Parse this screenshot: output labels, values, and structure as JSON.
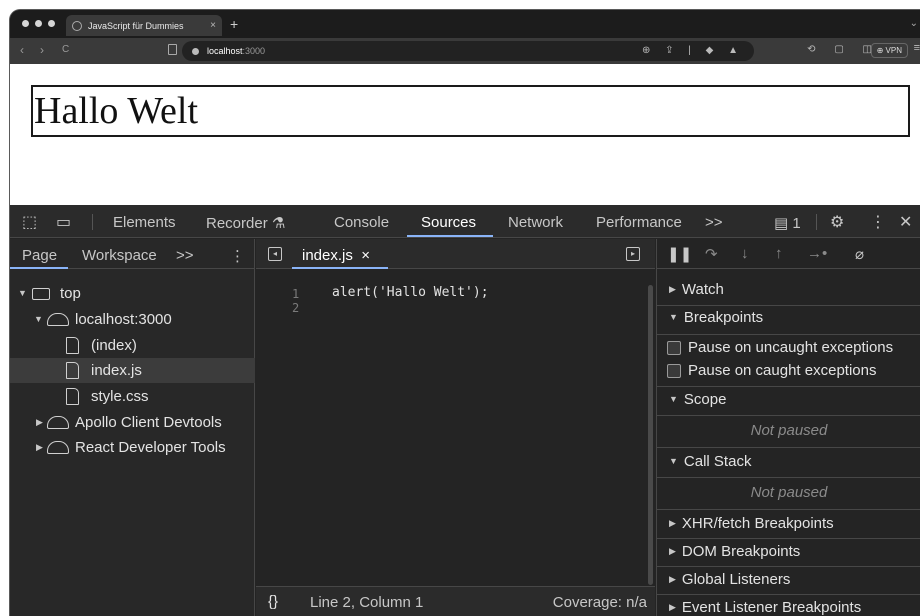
{
  "browser": {
    "tab_title": "JavaScript für Dummies",
    "tab_close": "×",
    "new_tab": "+",
    "nav_back": "‹",
    "nav_forward": "›",
    "nav_reload": "C",
    "url_host": "localhost",
    "url_port": ":3000",
    "vpn_label": "VPN"
  },
  "page": {
    "heading": "Hallo Welt"
  },
  "devtools": {
    "tabs": [
      "Elements",
      "Recorder",
      "Console",
      "Sources",
      "Network",
      "Performance"
    ],
    "active_tab": "Sources",
    "more_tabs": ">>",
    "issues_count": "1",
    "navigator": {
      "tabs": [
        "Page",
        "Workspace"
      ],
      "more": ">>",
      "tree": [
        {
          "label": "top",
          "icon": "frame-icon",
          "expanded": true,
          "level": 0
        },
        {
          "label": "localhost:3000",
          "icon": "cloud-icon",
          "expanded": true,
          "level": 1
        },
        {
          "label": "(index)",
          "icon": "file-icon",
          "level": 2
        },
        {
          "label": "index.js",
          "icon": "file-icon",
          "level": 2,
          "selected": true
        },
        {
          "label": "style.css",
          "icon": "file-icon",
          "level": 2
        },
        {
          "label": "Apollo Client Devtools",
          "icon": "cloud-icon",
          "expanded": false,
          "level": 1
        },
        {
          "label": "React Developer Tools",
          "icon": "cloud-icon",
          "expanded": false,
          "level": 1
        }
      ]
    },
    "editor": {
      "file_tab": "index.js",
      "close": "×",
      "line_numbers": [
        "1",
        "2"
      ],
      "code_line_1": "alert('Hallo Welt');",
      "status_braces": "{}",
      "status_position": "Line 2, Column 1",
      "coverage": "Coverage: n/a"
    },
    "debugger": {
      "watch": "Watch",
      "breakpoints": "Breakpoints",
      "pause_uncaught": "Pause on uncaught exceptions",
      "pause_caught": "Pause on caught exceptions",
      "scope": "Scope",
      "scope_status": "Not paused",
      "call_stack": "Call Stack",
      "call_stack_status": "Not paused",
      "xhr": "XHR/fetch Breakpoints",
      "dom": "DOM Breakpoints",
      "global": "Global Listeners",
      "event": "Event Listener Breakpoints"
    }
  },
  "colors": {
    "accent": "#8ab4f8",
    "devtools_bg": "#242424",
    "panel_bg": "#2b2b2b"
  }
}
